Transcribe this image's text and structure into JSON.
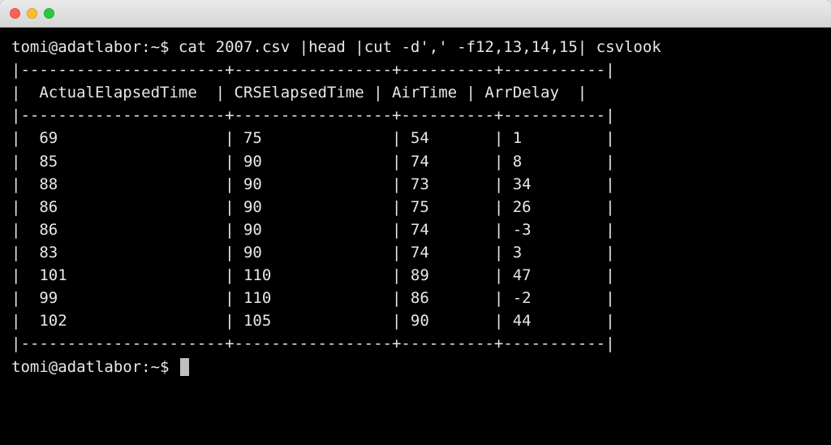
{
  "titlebar": {},
  "prompt": {
    "user_host_path": "tomi@adatlabor:~$",
    "command": "cat 2007.csv |head |cut -d',' -f12,13,14,15| csvlook"
  },
  "table": {
    "sep_top": "|----------------------+-----------------+----------+-----------|",
    "header_row": "|  ActualElapsedTime  | CRSElapsedTime | AirTime | ArrDelay  |",
    "sep_mid": "|----------------------+-----------------+----------+-----------|",
    "rows": [
      "|  69                  | 75              | 54       | 1         |",
      "|  85                  | 90              | 74       | 8         |",
      "|  88                  | 90              | 73       | 34        |",
      "|  86                  | 90              | 75       | 26        |",
      "|  86                  | 90              | 74       | -3        |",
      "|  83                  | 90              | 74       | 3         |",
      "|  101                 | 110             | 89       | 47        |",
      "|  99                  | 110             | 86       | -2        |",
      "|  102                 | 105             | 90       | 44        |"
    ],
    "sep_bot": "|----------------------+-----------------+----------+-----------|"
  },
  "prompt2": {
    "user_host_path": "tomi@adatlabor:~$"
  },
  "chart_data": {
    "type": "table",
    "columns": [
      "ActualElapsedTime",
      "CRSElapsedTime",
      "AirTime",
      "ArrDelay"
    ],
    "rows": [
      [
        69,
        75,
        54,
        1
      ],
      [
        85,
        90,
        74,
        8
      ],
      [
        88,
        90,
        73,
        34
      ],
      [
        86,
        90,
        75,
        26
      ],
      [
        86,
        90,
        74,
        -3
      ],
      [
        83,
        90,
        74,
        3
      ],
      [
        101,
        110,
        89,
        47
      ],
      [
        99,
        110,
        86,
        -2
      ],
      [
        102,
        105,
        90,
        44
      ]
    ]
  }
}
